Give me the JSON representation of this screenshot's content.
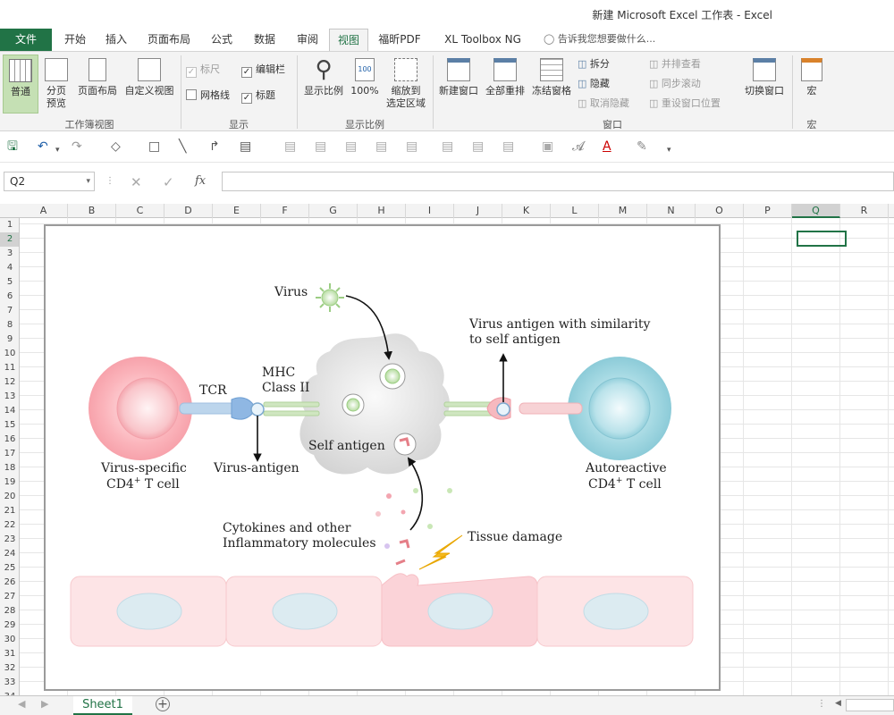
{
  "window": {
    "title": "新建 Microsoft Excel 工作表 - Excel"
  },
  "ribbon_tabs": [
    "文件",
    "开始",
    "插入",
    "页面布局",
    "公式",
    "数据",
    "审阅",
    "视图",
    "福昕PDF",
    "XL Toolbox NG"
  ],
  "tell_me": "告诉我您想要做什么...",
  "ribbon": {
    "workbook_views": {
      "group": "工作簿视图",
      "normal": "普通",
      "page_break": [
        "分页",
        "预览"
      ],
      "page_layout": "页面布局",
      "custom": "自定义视图"
    },
    "show": {
      "group": "显示",
      "ruler": "标尺",
      "formula_bar": "编辑栏",
      "gridlines": "网格线",
      "headings": "标题"
    },
    "zoom": {
      "group": "显示比例",
      "zoom": "显示比例",
      "hundred": "100%",
      "zoom_sel": [
        "缩放到",
        "选定区域"
      ]
    },
    "window": {
      "group": "窗口",
      "new_window": "新建窗口",
      "arrange_all": "全部重排",
      "freeze": "冻结窗格",
      "split": "拆分",
      "hide": "隐藏",
      "unhide": "取消隐藏",
      "side_by_side": "并排查看",
      "sync_scroll": "同步滚动",
      "reset_pos": "重设窗口位置",
      "switch": "切换窗口"
    },
    "macros": {
      "group": "宏",
      "macro": "宏"
    }
  },
  "formula_bar": {
    "cell_ref": "Q2",
    "fx": "fx",
    "value": ""
  },
  "columns": [
    "A",
    "B",
    "C",
    "D",
    "E",
    "F",
    "G",
    "H",
    "I",
    "J",
    "K",
    "L",
    "M",
    "N",
    "O",
    "P",
    "Q",
    "R"
  ],
  "rows": [
    "1",
    "2",
    "3",
    "4",
    "5",
    "6",
    "7",
    "8",
    "9",
    "10",
    "11",
    "12",
    "13",
    "14",
    "15",
    "16",
    "17",
    "18",
    "19",
    "20",
    "21",
    "22",
    "23",
    "24",
    "25",
    "26",
    "27",
    "28",
    "29",
    "30",
    "31",
    "32",
    "33",
    "34"
  ],
  "selected": {
    "column": "Q",
    "row": "2"
  },
  "diagram": {
    "virus": "Virus",
    "tcr": "TCR",
    "mhc": [
      "MHC",
      "Class II"
    ],
    "virus_antigen_similar": [
      "Virus antigen with similarity",
      "to self antigen"
    ],
    "self_antigen": "Self antigen",
    "virus_specific": [
      "Virus-specific",
      "CD4",
      "+",
      " T cell"
    ],
    "virus_antigen": "Virus-antigen",
    "autoreactive": [
      "Autoreactive",
      "CD4",
      "+",
      " T cell"
    ],
    "cytokines": [
      "Cytokines and other",
      "Inflammatory molecules"
    ],
    "tissue_damage": "Tissue damage"
  },
  "sheets": [
    "Sheet1"
  ]
}
